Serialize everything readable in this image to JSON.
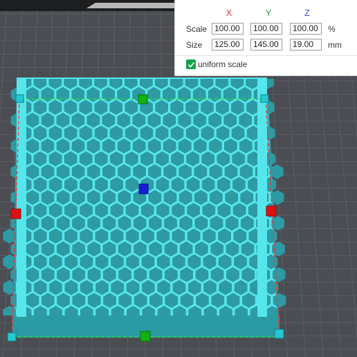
{
  "colors": {
    "background": "#4b4d53",
    "grid_line": "#5c5e64",
    "bed_top": "#1d1e20",
    "bed_accent": "#b7b7b7",
    "part_face": "#55e6ec",
    "part_side": "#2da9b2",
    "cell_fill": "#2d9aa4",
    "axis_x": "#e23b3b",
    "axis_y": "#2e9b3a",
    "axis_z": "#2f4fd6",
    "handle_red": "#e01010",
    "handle_green": "#12b012",
    "handle_blue": "#1a1ad8",
    "handle_corner": "#24c8d2",
    "bbox_red": "#ff3030",
    "bbox_green": "#30e030",
    "check_green": "#15a24b"
  },
  "scale_panel": {
    "axes": {
      "x": "X",
      "y": "Y",
      "z": "Z"
    },
    "scale": {
      "label": "Scale",
      "x": "100.00",
      "y": "100.00",
      "z": "100.00",
      "unit": "%"
    },
    "size": {
      "label": "Size",
      "x": "125.00",
      "y": "145.00",
      "z": "19.00",
      "unit": "mm"
    },
    "uniform_scale": {
      "label": "uniform scale",
      "checked": true,
      "check_icon": "check-icon"
    }
  }
}
